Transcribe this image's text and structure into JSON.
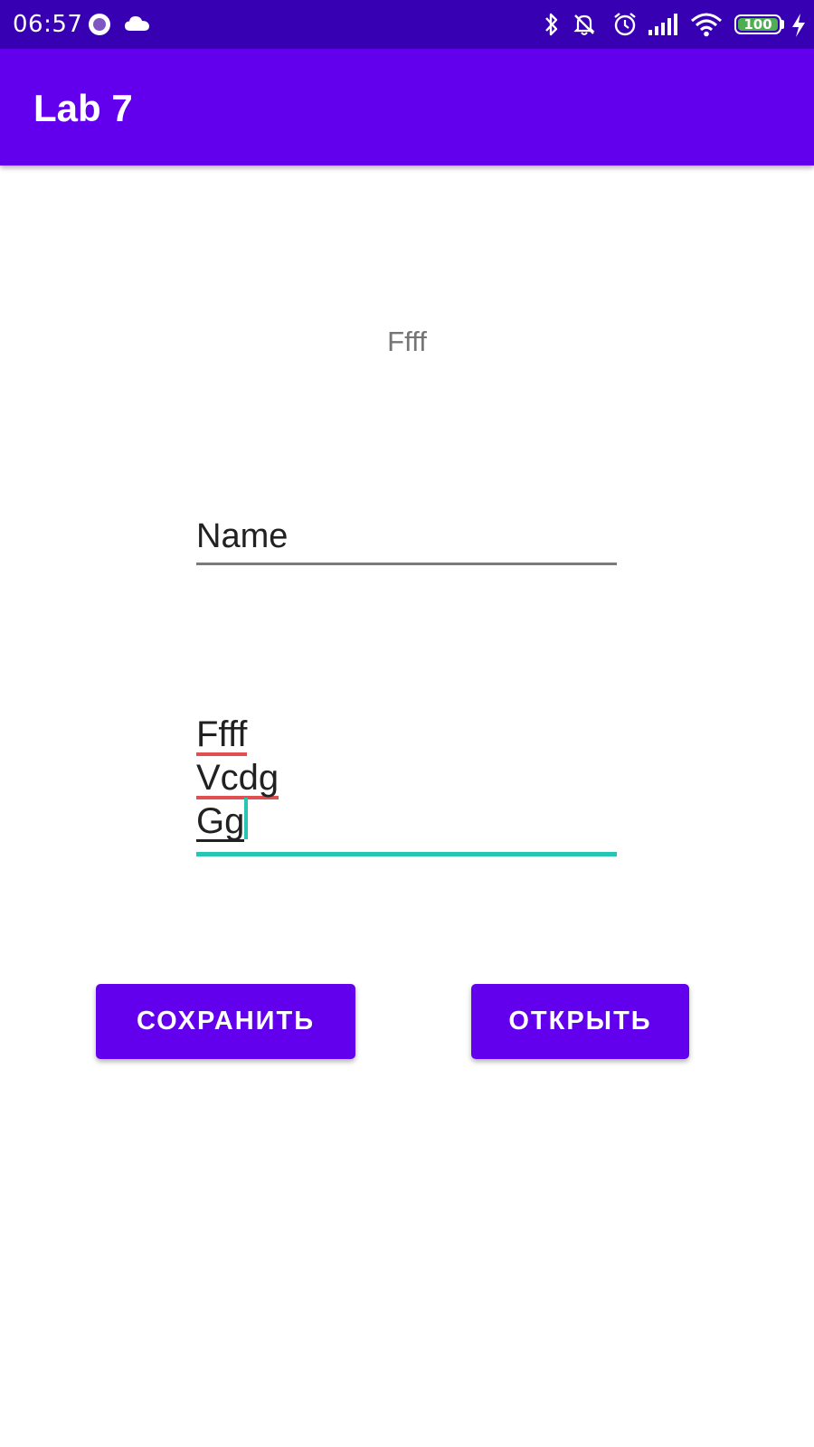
{
  "status_bar": {
    "time": "06:57",
    "battery_level": "100",
    "battery_fraction": 1.0,
    "icons": [
      "app-notification-icon",
      "cloud-icon",
      "bluetooth-icon",
      "vibrate-off-icon",
      "alarm-icon",
      "signal-icon",
      "wifi-icon",
      "battery-icon",
      "charging-icon"
    ]
  },
  "app_bar": {
    "title": "Lab 7"
  },
  "content": {
    "label_text": "Ffff",
    "name_field_value": "Name",
    "multiline_lines": [
      "Ffff",
      "Vcdg",
      "Gg"
    ]
  },
  "buttons": {
    "save_label": "СОХРАНИТЬ",
    "open_label": "ОТКРЫТЬ"
  },
  "colors": {
    "status_bar": "#3700b3",
    "primary": "#6200ee",
    "accent": "#26c6b4",
    "spellcheck": "#e05050",
    "battery": "#4caf50"
  }
}
